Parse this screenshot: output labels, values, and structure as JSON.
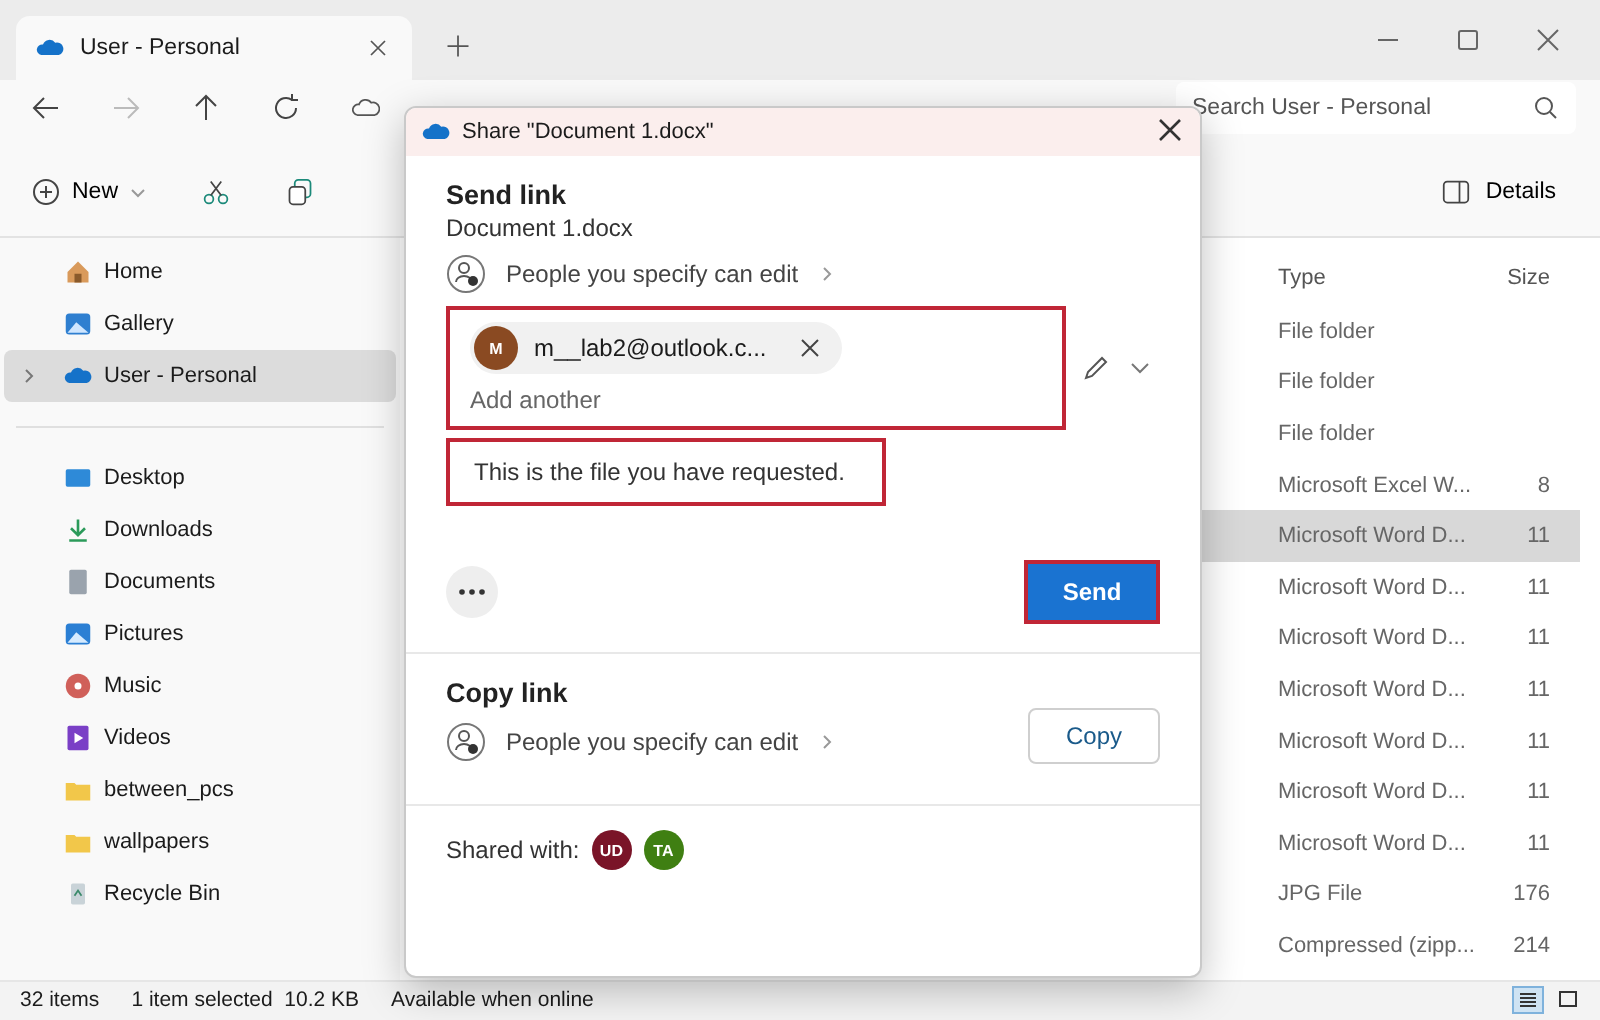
{
  "tab": {
    "title": "User - Personal"
  },
  "search": {
    "placeholder": "Search User - Personal"
  },
  "toolbar": {
    "new_label": "New",
    "details_label": "Details"
  },
  "sidebar": {
    "top_items": [
      {
        "label": "Home",
        "kind": "home",
        "selected": false
      },
      {
        "label": "Gallery",
        "kind": "gallery",
        "selected": false
      },
      {
        "label": "User - Personal",
        "kind": "cloud",
        "selected": true
      }
    ],
    "pinned_items": [
      {
        "label": "Desktop",
        "kind": "desktop",
        "selected": false
      },
      {
        "label": "Downloads",
        "kind": "downloads",
        "selected": false
      },
      {
        "label": "Documents",
        "kind": "documents",
        "selected": false
      },
      {
        "label": "Pictures",
        "kind": "pictures",
        "selected": false
      },
      {
        "label": "Music",
        "kind": "music",
        "selected": false
      },
      {
        "label": "Videos",
        "kind": "videos",
        "selected": false
      },
      {
        "label": "between_pcs",
        "kind": "folder",
        "selected": false
      },
      {
        "label": "wallpapers",
        "kind": "folder",
        "selected": false
      },
      {
        "label": "Recycle Bin",
        "kind": "bin",
        "selected": false
      }
    ]
  },
  "table": {
    "columns": [
      "Type",
      "Size"
    ],
    "rows": [
      {
        "type": "File folder",
        "size": "",
        "selected": false
      },
      {
        "type": "File folder",
        "size": "",
        "selected": false
      },
      {
        "type": "File folder",
        "size": "",
        "selected": false
      },
      {
        "type": "Microsoft Excel W...",
        "size": "8",
        "selected": false
      },
      {
        "type": "Microsoft Word D...",
        "size": "11",
        "selected": true
      },
      {
        "type": "Microsoft Word D...",
        "size": "11",
        "selected": false
      },
      {
        "type": "Microsoft Word D...",
        "size": "11",
        "selected": false
      },
      {
        "type": "Microsoft Word D...",
        "size": "11",
        "selected": false
      },
      {
        "type": "Microsoft Word D...",
        "size": "11",
        "selected": false
      },
      {
        "type": "Microsoft Word D...",
        "size": "11",
        "selected": false
      },
      {
        "type": "Microsoft Word D...",
        "size": "11",
        "selected": false
      },
      {
        "type": "JPG File",
        "size": "176",
        "selected": false
      },
      {
        "type": "Compressed (zipp...",
        "size": "214",
        "selected": false
      }
    ]
  },
  "status_bar": {
    "count": "32 items",
    "selection": "1 item selected  10.2 KB",
    "availability": "Available when online",
    "views": [
      {
        "kind": "details",
        "selected": true
      },
      {
        "kind": "tiles",
        "selected": false
      }
    ]
  },
  "dialog": {
    "title": "Share \"Document 1.docx\"",
    "send": {
      "heading": "Send link",
      "filename": "Document 1.docx",
      "permission": "People you specify can edit",
      "recipients": [
        {
          "initial": "M",
          "email": "m__lab2@outlook.c...",
          "color": "#8a4a22"
        }
      ],
      "recipients_placeholder": "Add another",
      "recipients_highlighted": true,
      "message": "This is the file you have requested.",
      "message_highlighted": true,
      "send_button": "Send",
      "send_highlighted": true
    },
    "copy": {
      "heading": "Copy link",
      "permission": "People you specify can edit",
      "button": "Copy"
    },
    "shared_with": {
      "label": "Shared with:",
      "people": [
        {
          "initials": "UD",
          "color": "#7a1428"
        },
        {
          "initials": "TA",
          "color": "#3f7f12"
        }
      ]
    }
  }
}
